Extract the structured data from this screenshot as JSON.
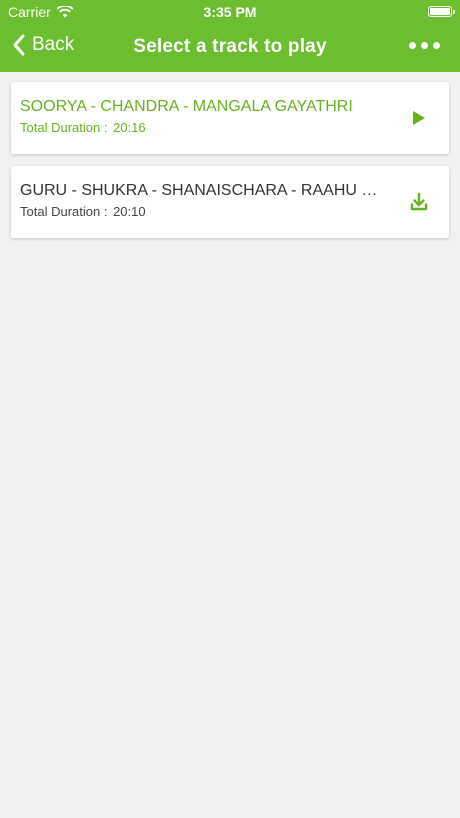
{
  "status_bar": {
    "carrier": "Carrier",
    "time": "3:35 PM"
  },
  "nav": {
    "back_label": "Back",
    "title": "Select a track to play"
  },
  "tracks": [
    {
      "title": "SOORYA - CHANDRA - MANGALA GAYATHRI",
      "duration_label": "Total Duration :",
      "duration": "20:16",
      "action_icon": "play-icon",
      "state": "active"
    },
    {
      "title": "GURU - SHUKRA - SHANAISCHARA - RAAHU - KETU GAYATHRI",
      "duration_label": "Total Duration :",
      "duration": "20:10",
      "action_icon": "download-icon",
      "state": "inactive"
    }
  ],
  "colors": {
    "brand_green": "#6cbd2f",
    "active_text": "#66b21f"
  }
}
